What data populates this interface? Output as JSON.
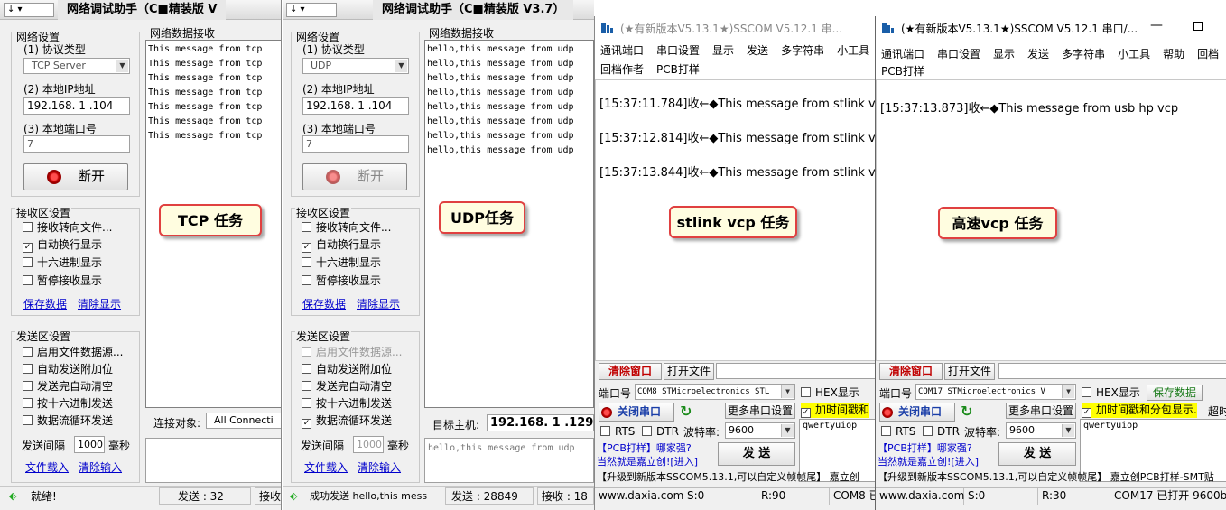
{
  "windows": {
    "tcp": {
      "sysmenu": "↓  ▾",
      "title": "网络调试助手（C■精装版 V",
      "net_settings": "网络设置",
      "protocol_label": "(1) 协议类型",
      "protocol_value": "TCP Server",
      "ip_label": "(2) 本地IP地址",
      "ip_value": "192.168. 1 .104",
      "port_label": "(3) 本地端口号",
      "port_value": "7",
      "action_button": "断开",
      "recv_settings": "接收区设置",
      "recv_opts": [
        "接收转向文件...",
        "自动换行显示",
        "十六进制显示",
        "暂停接收显示"
      ],
      "save_data": "保存数据",
      "clear_display": "清除显示",
      "send_settings": "发送区设置",
      "send_opts": [
        "启用文件数据源...",
        "自动发送附加位",
        "发送完自动清空",
        "按十六进制发送",
        "数据流循环发送"
      ],
      "interval_label": "发送间隔",
      "interval_value": "1000",
      "interval_unit": "毫秒",
      "load_file": "文件载入",
      "clear_input": "清除输入",
      "recv_title": "网络数据接收",
      "recv_lines": [
        "This message from tcp",
        "This message from tcp",
        "This message from tcp",
        "This message from tcp",
        "This message from tcp",
        "This message from tcp",
        "This message from tcp",
        "This message from tcp"
      ],
      "conn_label": "连接对象:",
      "conn_value": "All Connecti",
      "status_text": "就绪!",
      "send_count": "发送 : 32",
      "recv_count": "接收"
    },
    "udp": {
      "sysmenu": "↓  ▾",
      "title": "网络调试助手（C■精装版 V3.7）",
      "net_settings": "网络设置",
      "protocol_label": "(1) 协议类型",
      "protocol_value": "UDP",
      "ip_label": "(2) 本地IP地址",
      "ip_value": "192.168. 1 .104",
      "port_label": "(3) 本地端口号",
      "port_value": "7",
      "action_button": "断开",
      "recv_settings": "接收区设置",
      "recv_opts": [
        "接收转向文件...",
        "自动换行显示",
        "十六进制显示",
        "暂停接收显示"
      ],
      "save_data": "保存数据",
      "clear_display": "清除显示",
      "send_settings": "发送区设置",
      "send_opts": [
        "启用文件数据源...",
        "自动发送附加位",
        "发送完自动清空",
        "按十六进制发送",
        "数据流循环发送"
      ],
      "interval_label": "发送间隔",
      "interval_value": "1000",
      "interval_unit": "毫秒",
      "load_file": "文件载入",
      "clear_input": "清除输入",
      "recv_title": "网络数据接收",
      "recv_lines": [
        "hello,this message from udp",
        "hello,this message from udp",
        "hello,this message from udp",
        "hello,this message from udp",
        "hello,this message from udp",
        "hello,this message from udp",
        "hello,this message from udp",
        "hello,this message from udp",
        "hello,this message from udp"
      ],
      "target_label": "目标主机:",
      "target_value": "192.168. 1 .129",
      "send_text": "hello,this message from udp",
      "status_text": "成功发送 hello,this mess",
      "send_count": "发送 : 28849",
      "recv_count": "接收 : 18"
    },
    "stlink": {
      "title": "(★有新版本V5.13.1★)SSCOM V5.12.1 串...",
      "menu1": [
        "通讯端口",
        "串口设置",
        "显示",
        "发送",
        "多字符串",
        "小工具"
      ],
      "menu2": [
        "回档作者",
        "PCB打样"
      ],
      "lines": [
        "[15:37:11.784]收←◆This message from stlink vcp",
        "[15:37:12.814]收←◆This message from stlink vcp",
        "[15:37:13.844]收←◆This message from stlink vcp"
      ],
      "clear_window": "清除窗口",
      "open_file": "打开文件",
      "port_label": "端口号",
      "port_value": "COM8 STMicroelectronics STL",
      "close_port": "关闭串口",
      "more_settings": "更多串口设置",
      "rts": "RTS",
      "dtr": "DTR",
      "baud_label": "波特率:",
      "baud_value": "9600",
      "hex_show": "HEX显示",
      "timestamp_opt": "加时间戳和",
      "send_text": "qwertyuiop",
      "pcb_ad": "【PCB打样】哪家强?",
      "pcb_ad2": "当然就是嘉立创![进入]",
      "send_btn": "发  送",
      "upgrade": "【升级到新版本SSCOM5.13.1,可以自定义帧帧尾】  嘉立创",
      "site": "www.daxia.com",
      "s_count": "S:0",
      "r_count": "R:90",
      "port_status": "COM8 已打"
    },
    "hp": {
      "title": "(★有新版本V5.13.1★)SSCOM V5.12.1 串口/...",
      "menu1": [
        "通讯端口",
        "串口设置",
        "显示",
        "发送",
        "多字符串",
        "小工具",
        "帮助",
        "回档"
      ],
      "menu2": [
        "PCB打样"
      ],
      "lines": [
        "[15:37:13.873]收←◆This  message from usb hp vcp"
      ],
      "clear_window": "清除窗口",
      "open_file": "打开文件",
      "port_label": "端口号",
      "port_value": "COM17 STMicroelectronics V",
      "close_port": "关闭串口",
      "more_settings": "更多串口设置",
      "rts": "RTS",
      "dtr": "DTR",
      "baud_label": "波特率:",
      "baud_value": "9600",
      "hex_show": "HEX显示",
      "save_data": "保存数据",
      "timestamp_opt": "加时间戳和分包显示.",
      "timeout": "超时",
      "send_text": "qwertyuiop",
      "pcb_ad": "【PCB打样】哪家强?",
      "pcb_ad2": "当然就是嘉立创![进入]",
      "send_btn": "发  送",
      "upgrade": "【升级到新版本SSCOM5.13.1,可以自定义帧帧尾】  嘉立创PCB打样-SMT贴",
      "site": "www.daxia.com",
      "s_count": "S:0",
      "r_count": "R:30",
      "port_status": "COM17 已打开  9600b"
    }
  },
  "callouts": {
    "tcp": "TCP 任务",
    "udp": "UDP任务",
    "stlink": "stlink vcp 任务",
    "hp": "高速vcp 任务"
  },
  "colors": {
    "callout_border": "#e04040",
    "callout_bg": "#fffde0",
    "link": "#0000cc",
    "highlight": "#ffff00"
  }
}
